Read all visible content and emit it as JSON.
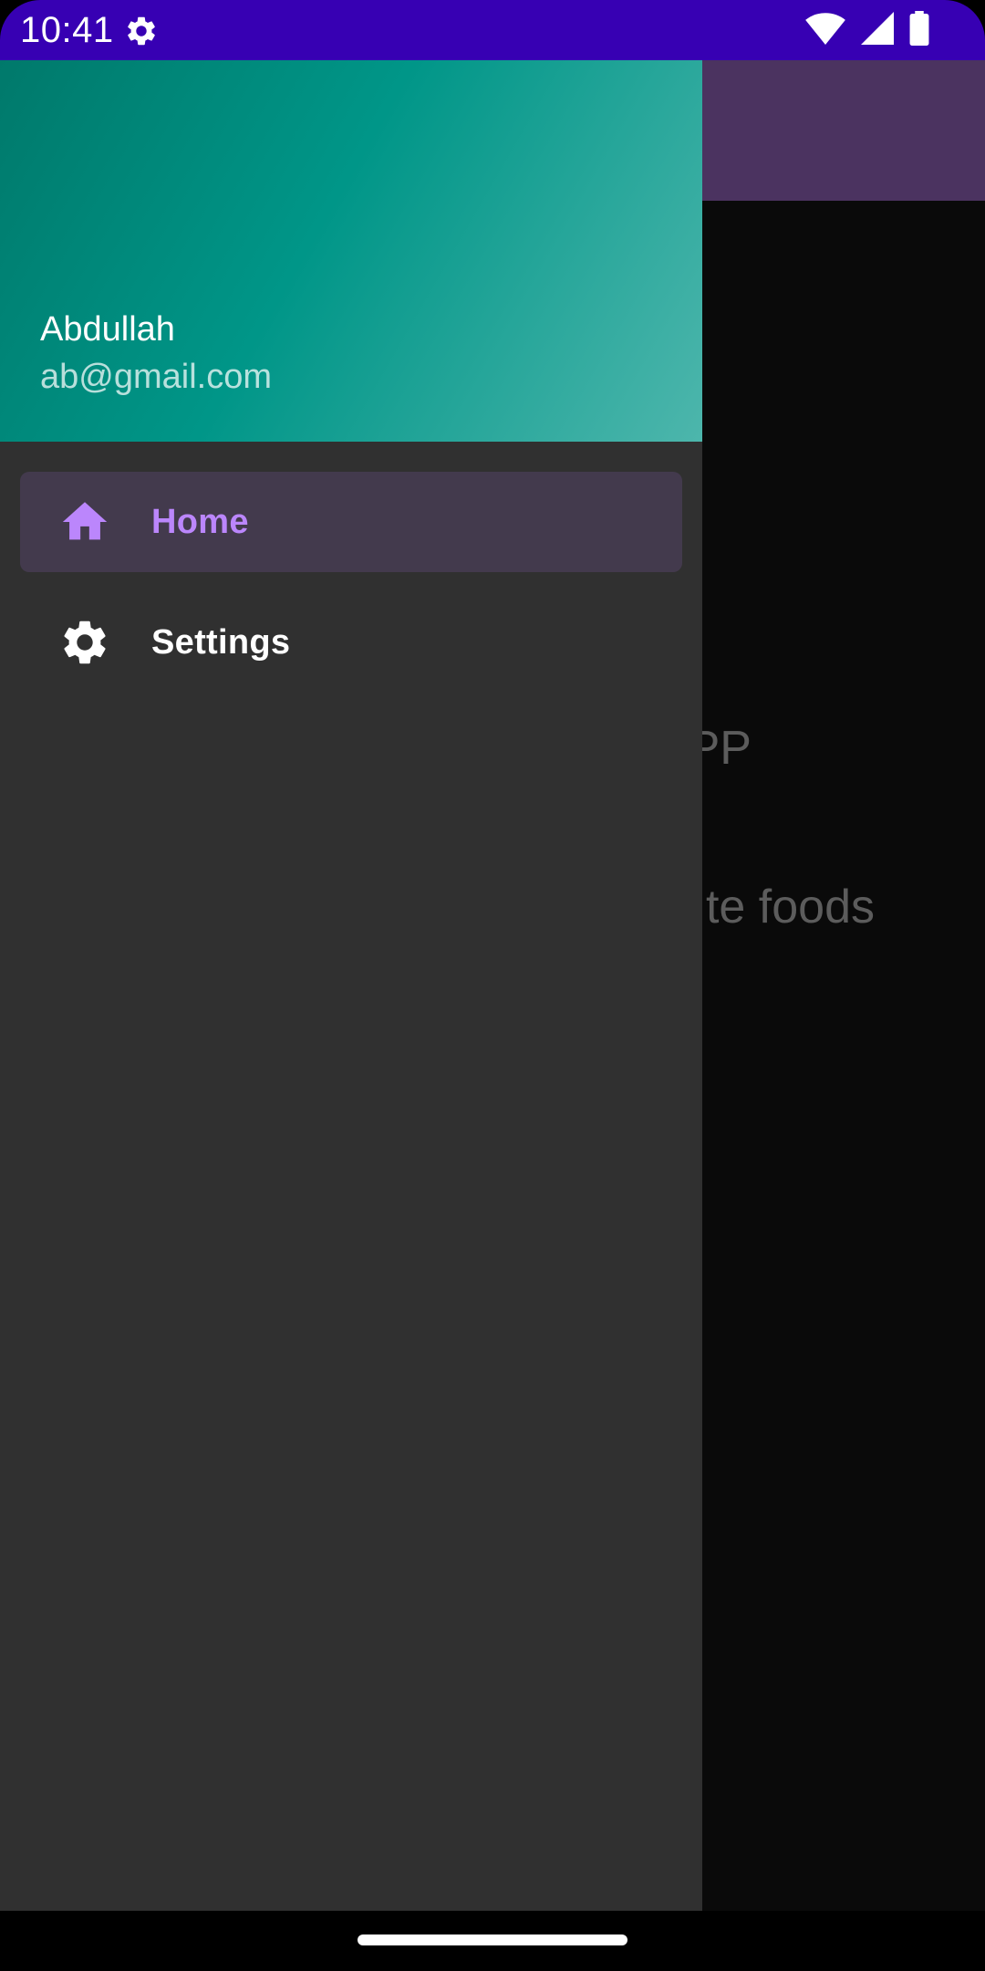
{
  "status_bar": {
    "time": "10:41",
    "icons": [
      "settings-gear-icon",
      "wifi-icon",
      "cellular-signal-icon",
      "battery-icon"
    ],
    "background": "#3700b3"
  },
  "app": {
    "title_partial": "PP",
    "subtitle_partial": "te foods",
    "toolbar_color": "#4b3360"
  },
  "drawer": {
    "header": {
      "name": "Abdullah",
      "email": "ab@gmail.com",
      "gradient": [
        "#00796b",
        "#009688",
        "#4db6ac"
      ]
    },
    "items": [
      {
        "label": "Home",
        "icon": "home-icon",
        "selected": true
      },
      {
        "label": "Settings",
        "icon": "settings-icon",
        "selected": false
      }
    ],
    "accent": "#bb86fc",
    "background": "#303030"
  }
}
